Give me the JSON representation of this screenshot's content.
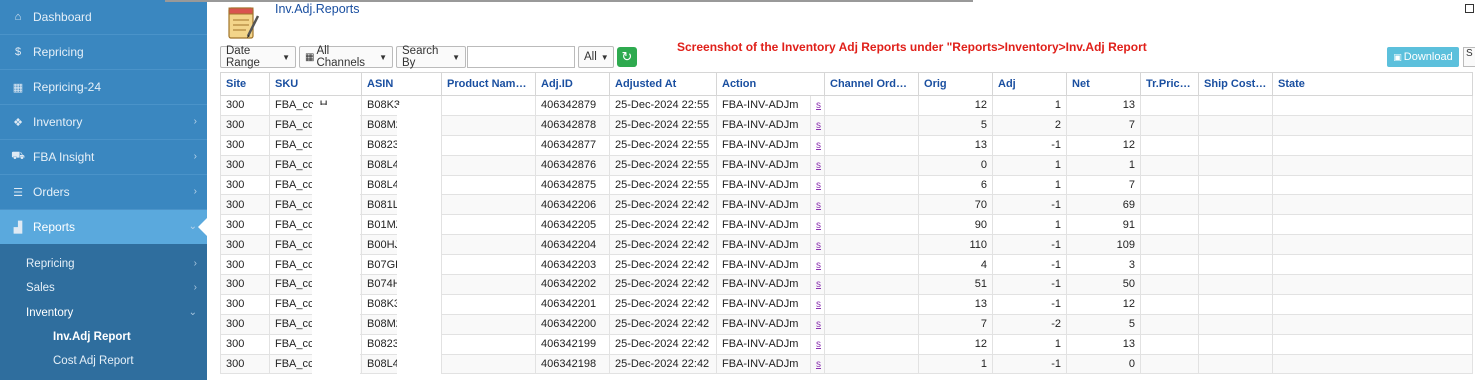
{
  "sidebar": {
    "items": [
      {
        "name": "dashboard",
        "label": "Dashboard",
        "icon": "home-icon",
        "glyph": "⌂"
      },
      {
        "name": "repricing",
        "label": "Repricing",
        "icon": "dollar-icon",
        "glyph": "$"
      },
      {
        "name": "repricing-24",
        "label": "Repricing-24",
        "icon": "calculator-icon",
        "glyph": "▦"
      },
      {
        "name": "inventory",
        "label": "Inventory",
        "icon": "cubes-icon",
        "glyph": "❖"
      },
      {
        "name": "fba-insight",
        "label": "FBA Insight",
        "icon": "truck-icon",
        "glyph": "⛟"
      },
      {
        "name": "orders",
        "label": "Orders",
        "icon": "list-icon",
        "glyph": "☰"
      },
      {
        "name": "reports",
        "label": "Reports",
        "icon": "bar-chart-icon",
        "glyph": "▟"
      }
    ],
    "submenu": {
      "repricing": "Repricing",
      "sales": "Sales",
      "inventory": "Inventory",
      "inv_adj_report": "Inv.Adj Report",
      "cost_adj_report": "Cost Adj Report"
    }
  },
  "header": {
    "title": "Inv.Adj.Reports",
    "annotation": "Screenshot of the Inventory Adj Reports under \"Reports>Inventory>Inv.Adj Report"
  },
  "toolbar": {
    "date_range": "Date Range",
    "channels": "All Channels",
    "search_by": "Search By",
    "search_value": "",
    "filter_select": "All",
    "download": "Download",
    "extra": "S"
  },
  "table": {
    "columns": [
      "Site",
      "SKU",
      "ASIN",
      "Product Name ...",
      "Adj.ID",
      "Adjusted At",
      "Action",
      "Channel OrderI...",
      "Orig",
      "Adj",
      "Net",
      "Tr.Price...",
      "Ship Cost ...",
      "State"
    ],
    "rows": [
      [
        "300",
        "FBA_cc_H",
        "B08K3",
        "",
        "406342879",
        "25-Dec-2024 22:55",
        "FBA-INV-ADJm",
        "s",
        "",
        "12",
        "1",
        "13",
        "",
        "",
        ""
      ],
      [
        "300",
        "FBA_cc_H",
        "B08M2",
        "",
        "406342878",
        "25-Dec-2024 22:55",
        "FBA-INV-ADJm",
        "s",
        "",
        "5",
        "2",
        "7",
        "",
        "",
        ""
      ],
      [
        "300",
        "FBA_cc_C",
        "B0823",
        "",
        "406342877",
        "25-Dec-2024 22:55",
        "FBA-INV-ADJm",
        "s",
        "",
        "13",
        "-1",
        "12",
        "",
        "",
        ""
      ],
      [
        "300",
        "FBA_cc_",
        "B08L4",
        "",
        "406342876",
        "25-Dec-2024 22:55",
        "FBA-INV-ADJm",
        "s",
        "",
        "0",
        "1",
        "1",
        "",
        "",
        ""
      ],
      [
        "300",
        "FBA_cc_    ca...",
        "B08L47",
        "",
        "406342875",
        "25-Dec-2024 22:55",
        "FBA-INV-ADJm",
        "s",
        "",
        "6",
        "1",
        "7",
        "",
        "",
        ""
      ],
      [
        "300",
        "FBA_cc_    ie_...",
        "B081L4",
        "",
        "406342206",
        "25-Dec-2024 22:42",
        "FBA-INV-ADJm",
        "s",
        "",
        "70",
        "-1",
        "69",
        "",
        "",
        ""
      ],
      [
        "300",
        "FBA_cc_    _rd",
        "B01MZ6",
        "",
        "406342205",
        "25-Dec-2024 22:42",
        "FBA-INV-ADJm",
        "s",
        "",
        "90",
        "1",
        "91",
        "",
        "",
        ""
      ],
      [
        "300",
        "FBA_cc_    _d...",
        "B00HJX",
        "",
        "406342204",
        "25-Dec-2024 22:42",
        "FBA-INV-ADJm",
        "s",
        "",
        "110",
        "-1",
        "109",
        "",
        "",
        ""
      ],
      [
        "300",
        "FBA_cc_    _d...",
        "B07GP",
        "",
        "406342203",
        "25-Dec-2024 22:42",
        "FBA-INV-ADJm",
        "s",
        "",
        "4",
        "-1",
        "3",
        "",
        "",
        ""
      ],
      [
        "300",
        "FBA_cc_    0_...",
        "B074H",
        "",
        "406342202",
        "25-Dec-2024 22:42",
        "FBA-INV-ADJm",
        "s",
        "",
        "51",
        "-1",
        "50",
        "",
        "",
        ""
      ],
      [
        "300",
        "FBA_cc_    326...",
        "B08K3",
        "",
        "406342201",
        "25-Dec-2024 22:42",
        "FBA-INV-ADJm",
        "s",
        "",
        "13",
        "-1",
        "12",
        "",
        "",
        ""
      ],
      [
        "300",
        "FBA_cc_    881...",
        "B08M2",
        "",
        "406342200",
        "25-Dec-2024 22:42",
        "FBA-INV-ADJm",
        "s",
        "",
        "7",
        "-2",
        "5",
        "",
        "",
        ""
      ],
      [
        "300",
        "FBA_cc_    _3...",
        "B0823",
        "",
        "406342199",
        "25-Dec-2024 22:42",
        "FBA-INV-ADJm",
        "s",
        "",
        "12",
        "1",
        "13",
        "",
        "",
        ""
      ],
      [
        "300",
        "FBA_cc_    m...",
        "B08L4",
        "",
        "406342198",
        "25-Dec-2024 22:42",
        "FBA-INV-ADJm",
        "s",
        "",
        "1",
        "-1",
        "0",
        "",
        "",
        ""
      ]
    ]
  },
  "colors": {
    "sidebar": "#3a87c0",
    "sidebar_active": "#5aa9dd",
    "submenu": "#2f6e9e",
    "header_text": "#1a4fa0",
    "annotation": "#e0201a",
    "refresh": "#2eaa4f",
    "download": "#5cc0dc"
  }
}
